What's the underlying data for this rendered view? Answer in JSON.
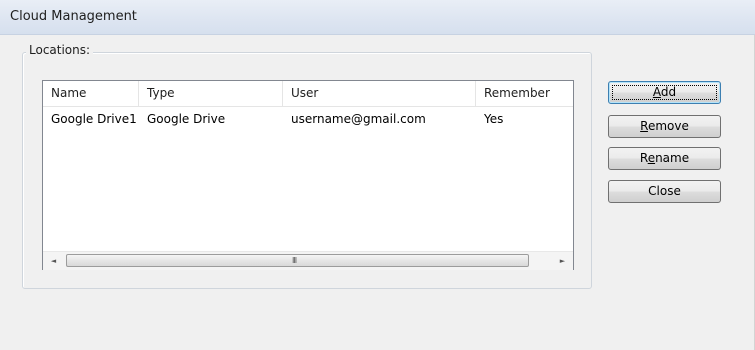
{
  "window": {
    "title": "Cloud Management"
  },
  "locations": {
    "group_label": "Locations:",
    "columns": [
      "Name",
      "Type",
      "User",
      "Remember"
    ],
    "rows": [
      [
        "Google Drive1",
        "Google Drive",
        "username@gmail.com",
        "Yes"
      ]
    ],
    "scrollbar": {
      "left_arrow": "◄",
      "right_arrow": "►",
      "grip": "III"
    }
  },
  "buttons": {
    "add": {
      "prefix": "",
      "accel": "A",
      "suffix": "dd"
    },
    "remove": {
      "prefix": "",
      "accel": "R",
      "suffix": "emove"
    },
    "rename": {
      "prefix": "R",
      "accel": "e",
      "suffix": "name"
    },
    "close": {
      "label": "Close"
    }
  },
  "colors": {
    "window_bg": "#f0f0f0",
    "titlebar_bg": "#dde5f1",
    "list_border": "#828790",
    "default_button_border": "#3c7fb1"
  }
}
